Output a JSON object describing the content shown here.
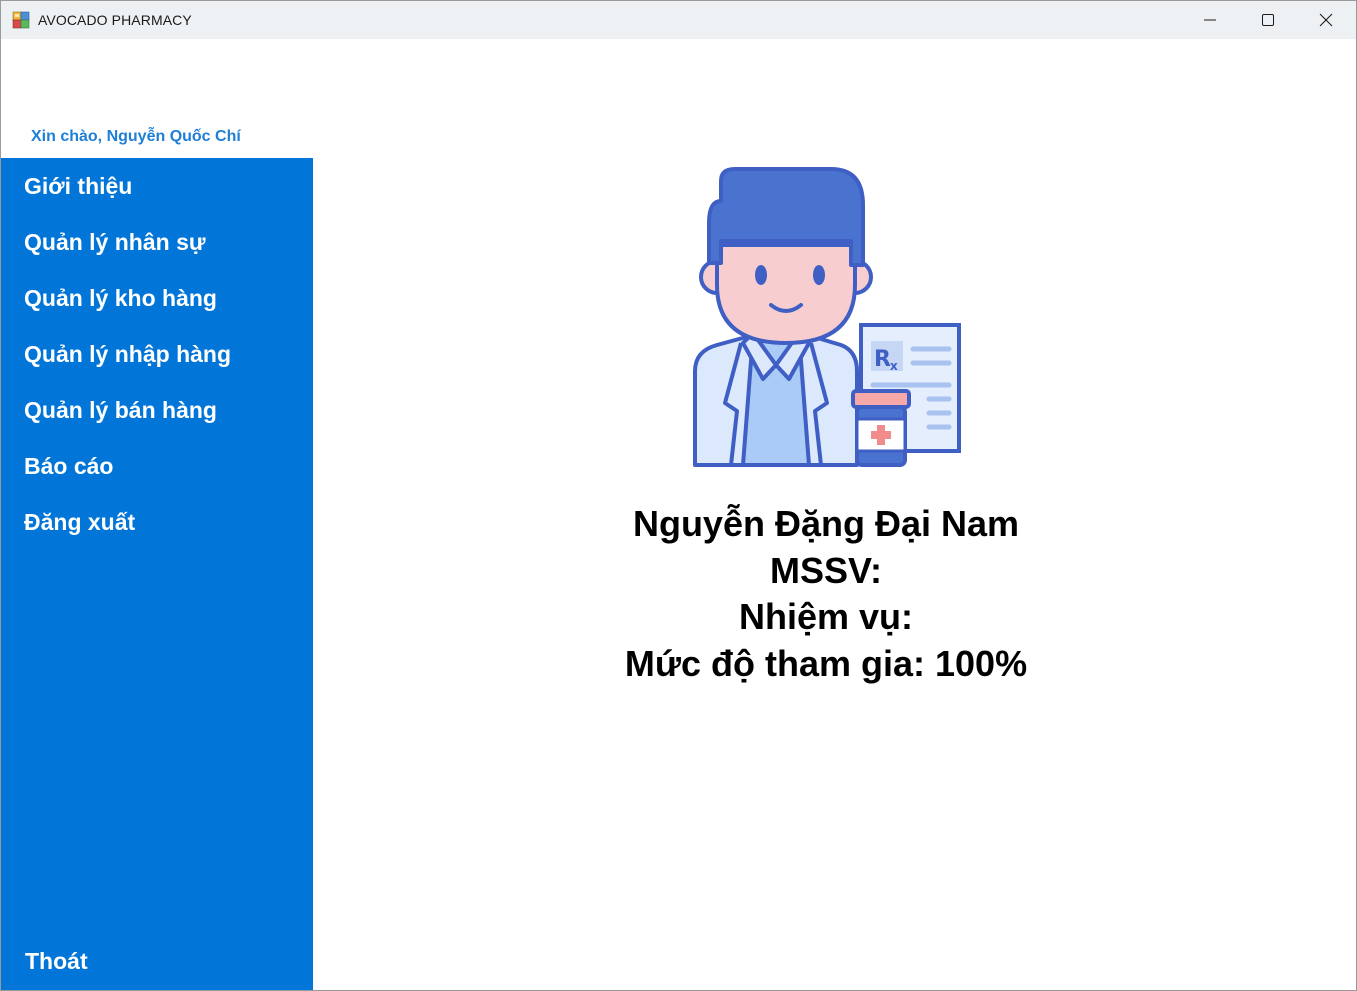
{
  "window": {
    "title": "AVOCADO PHARMACY",
    "controls": {
      "minimize": "minimize-icon",
      "maximize": "maximize-icon",
      "close": "close-icon"
    }
  },
  "greeting": "Xin chào, Nguyễn Quốc Chí",
  "sidebar": {
    "items": [
      {
        "label": "Giới thiệu"
      },
      {
        "label": "Quản lý nhân sự"
      },
      {
        "label": "Quản lý kho hàng"
      },
      {
        "label": "Quản lý nhập hàng"
      },
      {
        "label": "Quản lý bán hàng"
      },
      {
        "label": "Báo cáo"
      },
      {
        "label": "Đăng xuất"
      }
    ],
    "exit_label": "Thoát"
  },
  "profile": {
    "name": "Nguyễn Đặng Đại Nam",
    "student_id": "MSSV:",
    "task": "Nhiệm vụ:",
    "participation": "Mức độ tham gia: 100%"
  },
  "colors": {
    "sidebar": "#0275d8",
    "greeting": "#1f7fd6",
    "titlebar": "#eef1f4"
  }
}
